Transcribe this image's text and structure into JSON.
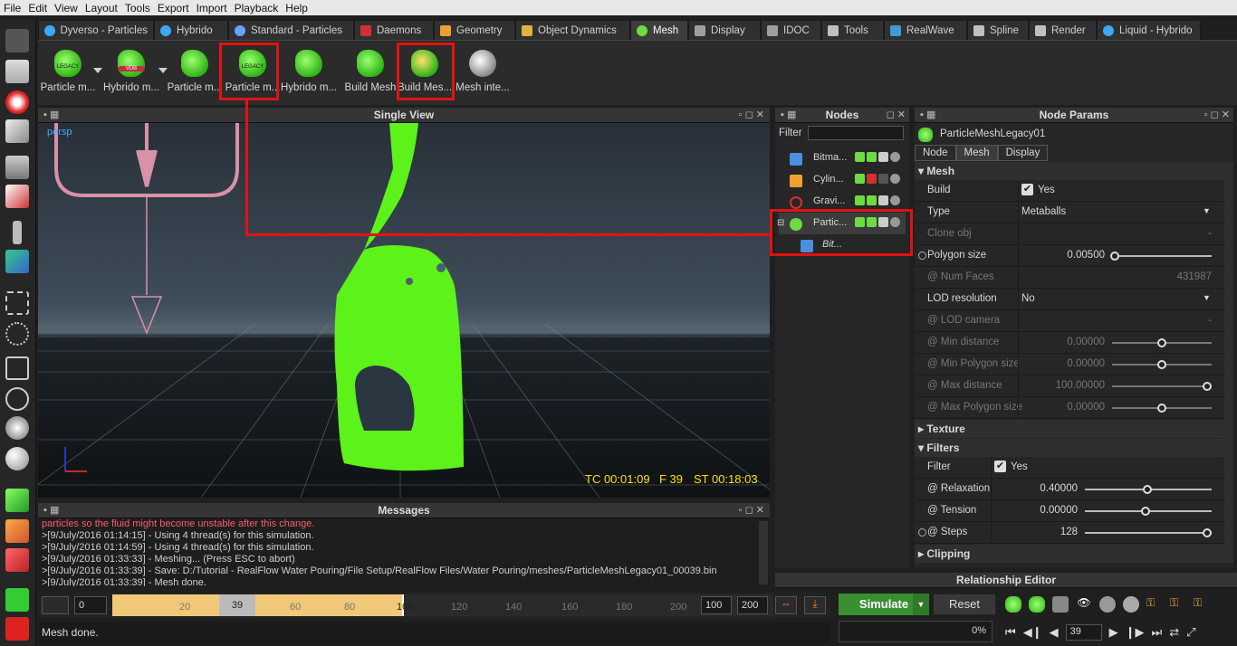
{
  "menu": [
    "File",
    "Edit",
    "View",
    "Layout",
    "Tools",
    "Export",
    "Import",
    "Playback",
    "Help"
  ],
  "tabs": [
    {
      "label": "Dyverso - Particles",
      "icon": "dyverso-icon",
      "color": "#3aa9ff",
      "active": false
    },
    {
      "label": "Hybrido",
      "icon": "hybrido-icon",
      "color": "#3aa9ff",
      "active": false
    },
    {
      "label": "Standard - Particles",
      "icon": "particles-icon",
      "color": "#6aa0ff",
      "active": false
    },
    {
      "label": "Daemons",
      "icon": "daemons-icon",
      "color": "#d43030",
      "active": false
    },
    {
      "label": "Geometry",
      "icon": "geometry-icon",
      "color": "#f0a030",
      "active": false
    },
    {
      "label": "Object Dynamics",
      "icon": "object-dynamics-icon",
      "color": "#e0b040",
      "active": false
    },
    {
      "label": "Mesh",
      "icon": "mesh-icon",
      "color": "#6cdc40",
      "active": true
    },
    {
      "label": "Display",
      "icon": "display-icon",
      "color": "#a0a0a0",
      "active": false
    },
    {
      "label": "IDOC",
      "icon": "idoc-icon",
      "color": "#a0a0a0",
      "active": false
    },
    {
      "label": "Tools",
      "icon": "tools-icon",
      "color": "#c0c0c0",
      "active": false
    },
    {
      "label": "RealWave",
      "icon": "realwave-icon",
      "color": "#3a9fd0",
      "active": false
    },
    {
      "label": "Spline",
      "icon": "spline-icon",
      "color": "#c0c0c0",
      "active": false
    },
    {
      "label": "Render",
      "icon": "render-icon",
      "color": "#c0c0c0",
      "active": false
    },
    {
      "label": "Liquid - Hybrido",
      "icon": "liquid-hybrido-icon",
      "color": "#3aa9ff",
      "active": false
    }
  ],
  "toolbar": {
    "buttons": [
      {
        "label": "Particle m...",
        "variant": "legacy"
      },
      {
        "label": "Hybrido m...",
        "variant": "vdb"
      },
      {
        "label": "Particle m...",
        "variant": "plain"
      },
      {
        "label": "Particle m...",
        "variant": "legacy"
      },
      {
        "label": "Hybrido m...",
        "variant": "plain"
      },
      {
        "label": "Build Mesh",
        "variant": "plain"
      },
      {
        "label": "Build Mes...",
        "variant": "plain"
      },
      {
        "label": "Mesh inte...",
        "variant": "white"
      }
    ]
  },
  "viewport": {
    "title": "Single View",
    "camera_label": "persp",
    "tc": "TC 00:01:09",
    "frame": "F 39",
    "st": "ST 00:18:03"
  },
  "messages": {
    "title": "Messages",
    "lines": [
      {
        "text": "particles so the  fluid might become unstable after this change.",
        "warn": true
      },
      {
        "text": ">[9/July/2016 01:14:15] - Using 4 thread(s) for this simulation.",
        "warn": false
      },
      {
        "text": ">[9/July/2016 01:14:59] - Using 4 thread(s) for this simulation.",
        "warn": false
      },
      {
        "text": ">[9/July/2016 01:33:33] - Meshing... (Press ESC to abort)",
        "warn": false
      },
      {
        "text": ">[9/July/2016 01:33:39] - Save: D:/Tutorial - RealFlow Water Pouring/File Setup/RealFlow Files/Water Pouring/meshes/ParticleMeshLegacy01_00039.bin",
        "warn": false
      },
      {
        "text": ">[9/July/2016 01:33:39] - Mesh done.",
        "warn": false
      }
    ]
  },
  "nodes": {
    "title": "Nodes",
    "filter_label": "Filter",
    "items": [
      {
        "name": "Bitma...",
        "icon": "bitmap-emitter-icon",
        "color": "#4a8fe0",
        "child": false
      },
      {
        "name": "Cylin...",
        "icon": "cylinder-icon",
        "color": "#f0a030",
        "child": false
      },
      {
        "name": "Gravi...",
        "icon": "gravity-icon",
        "color": "#d43030",
        "child": false
      },
      {
        "name": "Partic...",
        "icon": "particle-mesh-icon",
        "color": "#6cdc40",
        "child": false,
        "selected": true
      },
      {
        "name": "Bit...",
        "icon": "bitmap-child-icon",
        "color": "#4a8fe0",
        "child": true
      }
    ]
  },
  "nodeparams": {
    "title": "Node Params",
    "node_name": "ParticleMeshLegacy01",
    "tabs": [
      "Node",
      "Mesh",
      "Display"
    ],
    "sections": {
      "mesh": "Mesh",
      "texture": "Texture",
      "filters": "Filters",
      "clipping": "Clipping"
    },
    "mesh_rows": [
      {
        "label": "Build",
        "value": "Yes",
        "kind": "check"
      },
      {
        "label": "Type",
        "value": "Metaballs",
        "kind": "dropdown"
      },
      {
        "label": "Clone obj",
        "value": "-",
        "kind": "dim"
      },
      {
        "label": "Polygon size",
        "value": "0.00500",
        "kind": "slider",
        "level": 0
      },
      {
        "label": "@ Num Faces",
        "value": "431987",
        "kind": "dim"
      },
      {
        "label": "LOD resolution",
        "value": "No",
        "kind": "dropdown"
      },
      {
        "label": "@ LOD camera",
        "value": "-",
        "kind": "dim"
      },
      {
        "label": "@ Min distance",
        "value": "0.00000",
        "kind": "dimslider",
        "level": 0.5
      },
      {
        "label": "@ Min Polygon size",
        "value": "0.00000",
        "kind": "dimslider",
        "level": 0.5
      },
      {
        "label": "@ Max distance",
        "value": "100.00000",
        "kind": "dimslider",
        "level": 1
      },
      {
        "label": "@ Max Polygon size",
        "value": "0.00000",
        "kind": "dimslider",
        "level": 0.5
      }
    ],
    "filter_rows": [
      {
        "label": "Filter",
        "value": "Yes",
        "kind": "check"
      },
      {
        "label": "@ Relaxation",
        "value": "0.40000",
        "kind": "slider",
        "level": 0.5
      },
      {
        "label": "@ Tension",
        "value": "0.00000",
        "kind": "slider",
        "level": 0.5
      },
      {
        "label": "@ Steps",
        "value": "128",
        "kind": "slider",
        "level": 1
      }
    ]
  },
  "relationship": {
    "title": "Relationship Editor"
  },
  "timeline": {
    "start": "0",
    "current": "39",
    "ticks": [
      "20",
      "40",
      "60",
      "80",
      "100",
      "120",
      "140",
      "160",
      "180",
      "200"
    ],
    "end_a": "100",
    "end_b": "200",
    "cached_to": 100,
    "max": 200
  },
  "sim": {
    "simulate": "Simulate",
    "reset": "Reset",
    "progress": "0%",
    "frame_field": "39"
  },
  "status": {
    "text": "Mesh done."
  }
}
